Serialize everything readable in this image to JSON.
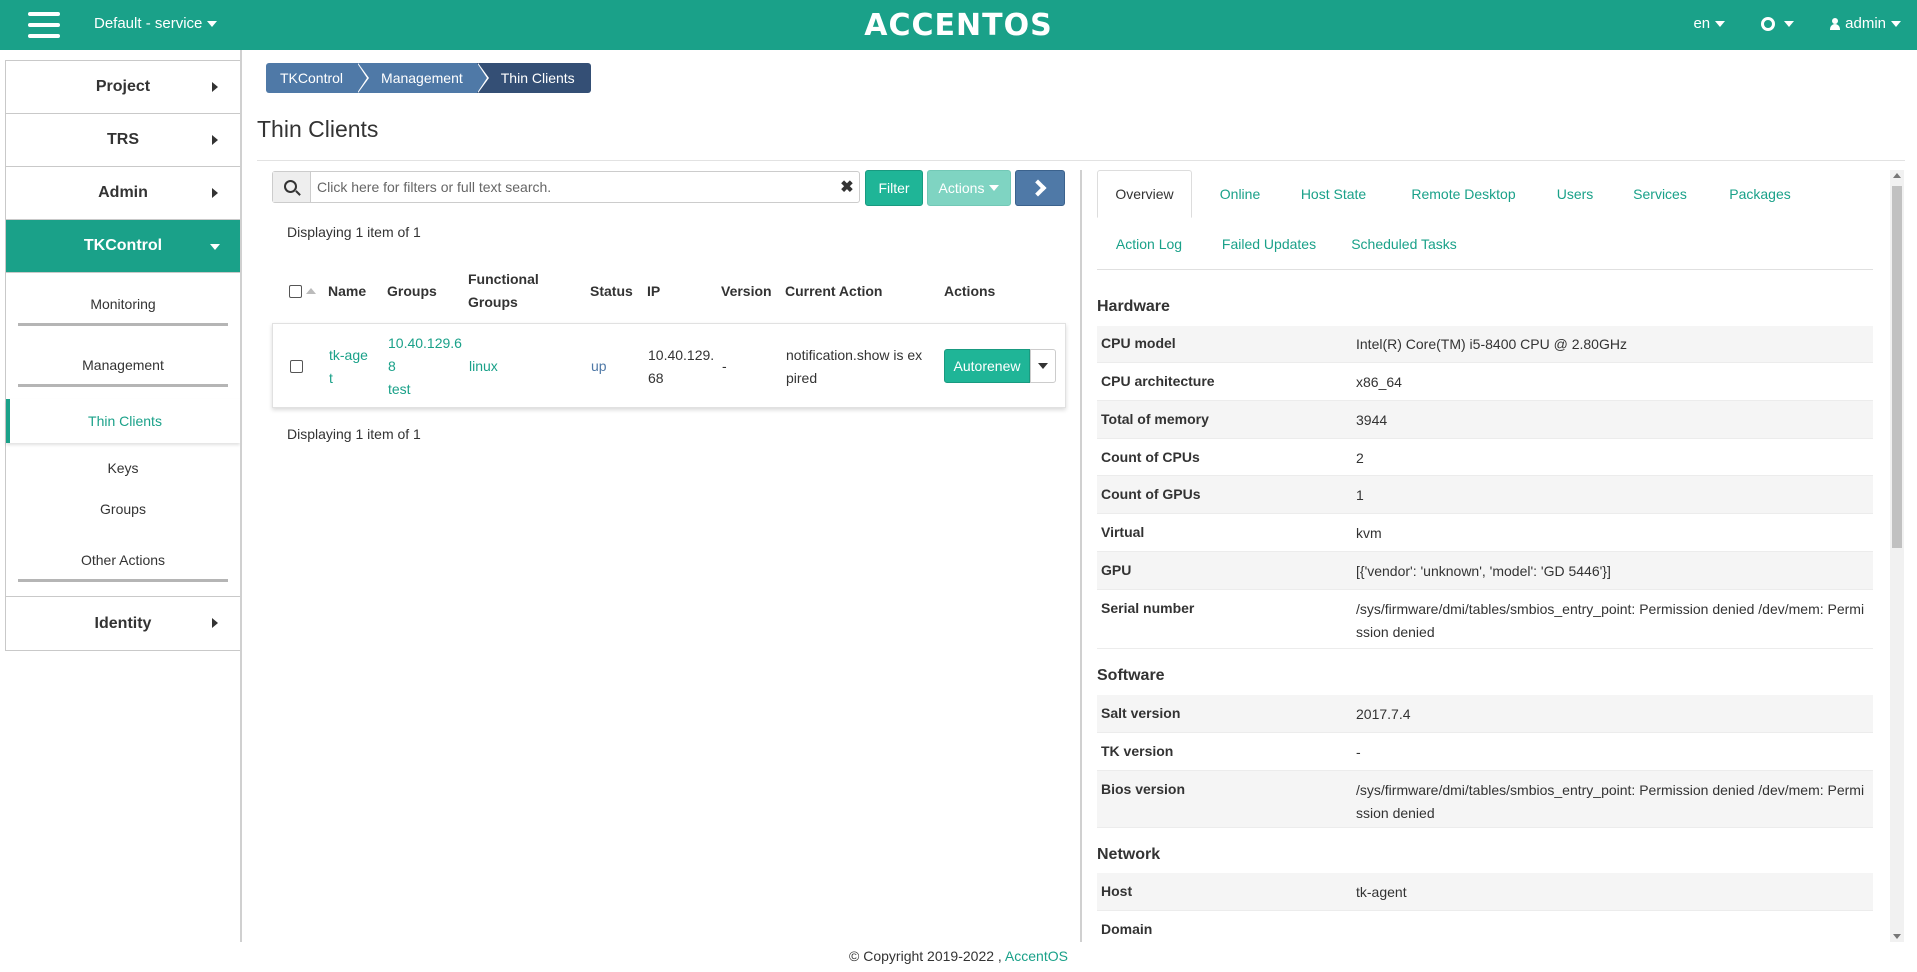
{
  "topbar": {
    "project": "Default - service",
    "logo": "ACCENTOS",
    "language": "en",
    "user": "admin"
  },
  "sidebar": {
    "project": "Project",
    "trs": "TRS",
    "admin": "Admin",
    "tkcontrol": "TKControl",
    "monitoring": "Monitoring",
    "management": "Management",
    "thin_clients": "Thin Clients",
    "keys": "Keys",
    "groups": "Groups",
    "other_actions": "Other Actions",
    "identity": "Identity"
  },
  "breadcrumb": [
    "TKControl",
    "Management",
    "Thin Clients"
  ],
  "page_title": "Thin Clients",
  "search": {
    "placeholder": "Click here for filters or full text search."
  },
  "buttons": {
    "filter": "Filter",
    "actions": "Actions"
  },
  "table": {
    "displaying_top": "Displaying 1 item of 1",
    "displaying_bottom": "Displaying 1 item of 1",
    "columns": {
      "name": "Name",
      "groups": "Groups",
      "functional_groups_1": "Functional",
      "functional_groups_2": "Groups",
      "status": "Status",
      "ip": "IP",
      "version": "Version",
      "current_action": "Current Action",
      "actions": "Actions"
    },
    "row": {
      "name_1": "tk-age",
      "name_2": "t",
      "groups_1": "10.40.129.6",
      "groups_2": "8",
      "groups_3": "test",
      "functional_group": "linux",
      "status": "up",
      "ip_1": "10.40.129.",
      "ip_2": "68",
      "version": "-",
      "current_action_1": "notification.show is ex",
      "current_action_2": "pired",
      "action_button": "Autorenew"
    }
  },
  "tabs": [
    "Overview",
    "Online",
    "Host State",
    "Remote Desktop",
    "Users",
    "Services",
    "Packages",
    "Action Log",
    "Failed Updates",
    "Scheduled Tasks"
  ],
  "details": {
    "hardware_title": "Hardware",
    "cpu_model_k": "CPU model",
    "cpu_model_v": "Intel(R) Core(TM) i5-8400 CPU @ 2.80GHz",
    "cpu_arch_k": "CPU architecture",
    "cpu_arch_v": "x86_64",
    "total_memory_k": "Total of memory",
    "total_memory_v": "3944",
    "count_cpus_k": "Count of CPUs",
    "count_cpus_v": "2",
    "count_gpus_k": "Count of GPUs",
    "count_gpus_v": "1",
    "virtual_k": "Virtual",
    "virtual_v": "kvm",
    "gpu_k": "GPU",
    "gpu_v": "[{'vendor': 'unknown', 'model': 'GD 5446'}]",
    "serial_k": "Serial number",
    "serial_v": "/sys/firmware/dmi/tables/smbios_entry_point: Permission denied /dev/mem: Permission denied",
    "software_title": "Software",
    "salt_k": "Salt version",
    "salt_v": "2017.7.4",
    "tk_k": "TK version",
    "tk_v": "-",
    "bios_k": "Bios version",
    "bios_v": "/sys/firmware/dmi/tables/smbios_entry_point: Permission denied /dev/mem: Permission denied",
    "network_title": "Network",
    "host_k": "Host",
    "host_v": "tk-agent",
    "domain_k": "Domain",
    "domain_v": ""
  },
  "footer": {
    "copyright": "© Copyright 2019-2022 ,",
    "link": "AccentOS"
  },
  "colors": {
    "brand": "#1aa189",
    "button_green": "#1fb597",
    "breadcrumb_blue": "#4f79a7",
    "breadcrumb_dark": "#344f75"
  }
}
